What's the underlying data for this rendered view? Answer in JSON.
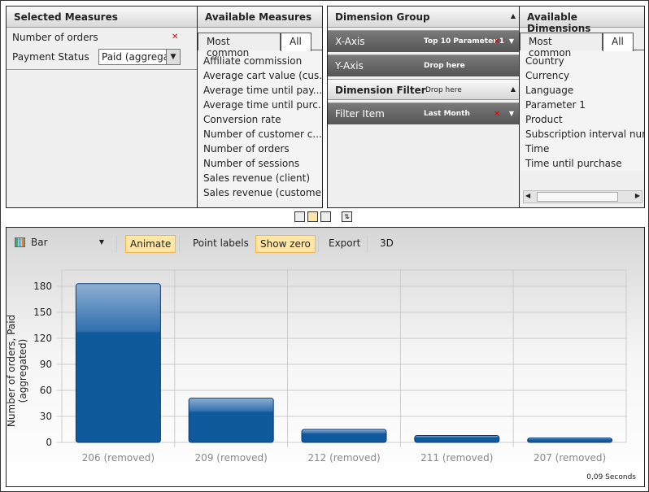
{
  "selected_measures": {
    "title": "Selected Measures",
    "items": [
      {
        "label": "Number of orders"
      },
      {
        "label": "Payment Status",
        "select_value": "Paid (aggrega"
      }
    ]
  },
  "available_measures": {
    "title": "Available Measures",
    "tabs": [
      "Most common",
      "All"
    ],
    "items": [
      "Affiliate commission",
      "Average cart value (cus...",
      "Average time until pay...",
      "Average time until purc...",
      "Conversion rate",
      "Number of customer c...",
      "Number of orders",
      "Number of sessions",
      "Sales revenue (client)",
      "Sales revenue (customer)"
    ]
  },
  "dimension_group": {
    "title": "Dimension Group",
    "x_axis": "X-Axis",
    "x_axis_value": "Top 10 Parameter 1",
    "y_axis": "Y-Axis",
    "y_axis_value": "Drop here"
  },
  "dimension_filter": {
    "title": "Dimension Filter",
    "drop": "Drop here",
    "item": "Filter Item",
    "item_value": "Last Month"
  },
  "available_dimensions": {
    "title": "Available Dimensions",
    "tabs": [
      "Most common",
      "All"
    ],
    "items": [
      "Country",
      "Currency",
      "Language",
      "Parameter 1",
      "Product",
      "Subscription interval number",
      "Time",
      "Time until purchase"
    ]
  },
  "toolbar": {
    "chart_type": "Bar",
    "animate": "Animate",
    "point_labels": "Point labels",
    "show_zero": "Show zero",
    "export": "Export",
    "three_d": "3D"
  },
  "footer": {
    "timing": "0,09 Seconds"
  },
  "chart_data": {
    "type": "bar",
    "categories": [
      "206 (removed)",
      "209 (removed)",
      "212 (removed)",
      "211 (removed)",
      "207 (removed)"
    ],
    "values": [
      183,
      51,
      15,
      8,
      5
    ],
    "ylabel": "Number of orders, Paid (aggregated)",
    "ylim": [
      0,
      200
    ],
    "yticks": [
      0,
      30,
      60,
      90,
      120,
      150,
      180
    ],
    "grid": true,
    "color": "#0f5a9c"
  }
}
